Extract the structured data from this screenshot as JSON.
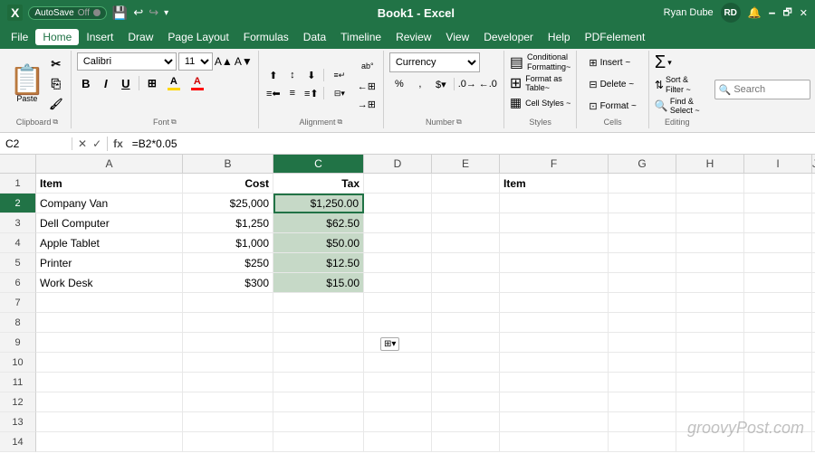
{
  "titleBar": {
    "autosave": "AutoSave",
    "off": "Off",
    "title": "Book1 - Excel",
    "user": "Ryan Dube",
    "initials": "RD",
    "minimize": "🗕",
    "restore": "🗗",
    "close": "✕"
  },
  "menuBar": {
    "items": [
      "File",
      "Home",
      "Insert",
      "Draw",
      "Page Layout",
      "Formulas",
      "Data",
      "Timeline",
      "Review",
      "View",
      "Developer",
      "Help",
      "PDFelement"
    ]
  },
  "ribbon": {
    "clipboard": {
      "label": "Clipboard",
      "paste": "Paste"
    },
    "font": {
      "label": "Font",
      "fontName": "Calibri",
      "fontSize": "11",
      "bold": "B",
      "italic": "I",
      "underline": "U",
      "border": "⊞",
      "fillColor": "A",
      "fontColor": "A"
    },
    "alignment": {
      "label": "Alignment"
    },
    "number": {
      "label": "Number",
      "format": "Currency"
    },
    "styles": {
      "label": "Styles",
      "conditional": "Conditional Formatting~",
      "formatAsTable": "Format as Table~",
      "cellStyles": "Cell Styles~"
    },
    "cells": {
      "label": "Cells",
      "insert": "Insert ~",
      "delete": "Delete ~",
      "format": "Format ~"
    },
    "editing": {
      "label": "Editing",
      "sigma": "Σ",
      "sortFilter": "Sort & Filter ~",
      "findSelect": "Find & Select ~"
    },
    "search": {
      "placeholder": "Search"
    }
  },
  "formulaBar": {
    "cellRef": "C2",
    "formula": "=B2*0.05"
  },
  "columns": [
    "A",
    "B",
    "C",
    "D",
    "E",
    "F",
    "G",
    "H",
    "I",
    "J"
  ],
  "rows": [
    {
      "num": 1,
      "cells": [
        {
          "col": "A",
          "val": "Item",
          "bold": true
        },
        {
          "col": "B",
          "val": "Cost",
          "bold": true,
          "align": "right"
        },
        {
          "col": "C",
          "val": "Tax",
          "bold": true,
          "align": "right"
        },
        {
          "col": "D",
          "val": ""
        },
        {
          "col": "E",
          "val": ""
        },
        {
          "col": "F",
          "val": "Item",
          "bold": true
        },
        {
          "col": "G",
          "val": ""
        },
        {
          "col": "H",
          "val": ""
        },
        {
          "col": "I",
          "val": ""
        }
      ]
    },
    {
      "num": 2,
      "cells": [
        {
          "col": "A",
          "val": "Company Van"
        },
        {
          "col": "B",
          "val": "$25,000",
          "align": "right"
        },
        {
          "col": "C",
          "val": "$1,250.00",
          "align": "right",
          "active": true,
          "tax": true
        },
        {
          "col": "D",
          "val": ""
        },
        {
          "col": "E",
          "val": ""
        },
        {
          "col": "F",
          "val": ""
        },
        {
          "col": "G",
          "val": ""
        },
        {
          "col": "H",
          "val": ""
        },
        {
          "col": "I",
          "val": ""
        }
      ]
    },
    {
      "num": 3,
      "cells": [
        {
          "col": "A",
          "val": "Dell Computer"
        },
        {
          "col": "B",
          "val": "$1,250",
          "align": "right"
        },
        {
          "col": "C",
          "val": "$62.50",
          "align": "right",
          "tax": true
        },
        {
          "col": "D",
          "val": ""
        },
        {
          "col": "E",
          "val": ""
        },
        {
          "col": "F",
          "val": ""
        },
        {
          "col": "G",
          "val": ""
        },
        {
          "col": "H",
          "val": ""
        },
        {
          "col": "I",
          "val": ""
        }
      ]
    },
    {
      "num": 4,
      "cells": [
        {
          "col": "A",
          "val": "Apple Tablet"
        },
        {
          "col": "B",
          "val": "$1,000",
          "align": "right"
        },
        {
          "col": "C",
          "val": "$50.00",
          "align": "right",
          "tax": true
        },
        {
          "col": "D",
          "val": ""
        },
        {
          "col": "E",
          "val": ""
        },
        {
          "col": "F",
          "val": ""
        },
        {
          "col": "G",
          "val": ""
        },
        {
          "col": "H",
          "val": ""
        },
        {
          "col": "I",
          "val": ""
        }
      ]
    },
    {
      "num": 5,
      "cells": [
        {
          "col": "A",
          "val": "Printer"
        },
        {
          "col": "B",
          "val": "$250",
          "align": "right"
        },
        {
          "col": "C",
          "val": "$12.50",
          "align": "right",
          "tax": true
        },
        {
          "col": "D",
          "val": ""
        },
        {
          "col": "E",
          "val": ""
        },
        {
          "col": "F",
          "val": ""
        },
        {
          "col": "G",
          "val": ""
        },
        {
          "col": "H",
          "val": ""
        },
        {
          "col": "I",
          "val": ""
        }
      ]
    },
    {
      "num": 6,
      "cells": [
        {
          "col": "A",
          "val": "Work Desk"
        },
        {
          "col": "B",
          "val": "$300",
          "align": "right"
        },
        {
          "col": "C",
          "val": "$15.00",
          "align": "right",
          "tax": true
        },
        {
          "col": "D",
          "val": ""
        },
        {
          "col": "E",
          "val": ""
        },
        {
          "col": "F",
          "val": ""
        },
        {
          "col": "G",
          "val": ""
        },
        {
          "col": "H",
          "val": ""
        },
        {
          "col": "I",
          "val": ""
        }
      ]
    },
    {
      "num": 7,
      "cells": []
    },
    {
      "num": 8,
      "cells": []
    },
    {
      "num": 9,
      "cells": []
    },
    {
      "num": 10,
      "cells": []
    },
    {
      "num": 11,
      "cells": []
    },
    {
      "num": 12,
      "cells": []
    },
    {
      "num": 13,
      "cells": []
    },
    {
      "num": 14,
      "cells": []
    }
  ],
  "watermark": "groovyPost.com"
}
